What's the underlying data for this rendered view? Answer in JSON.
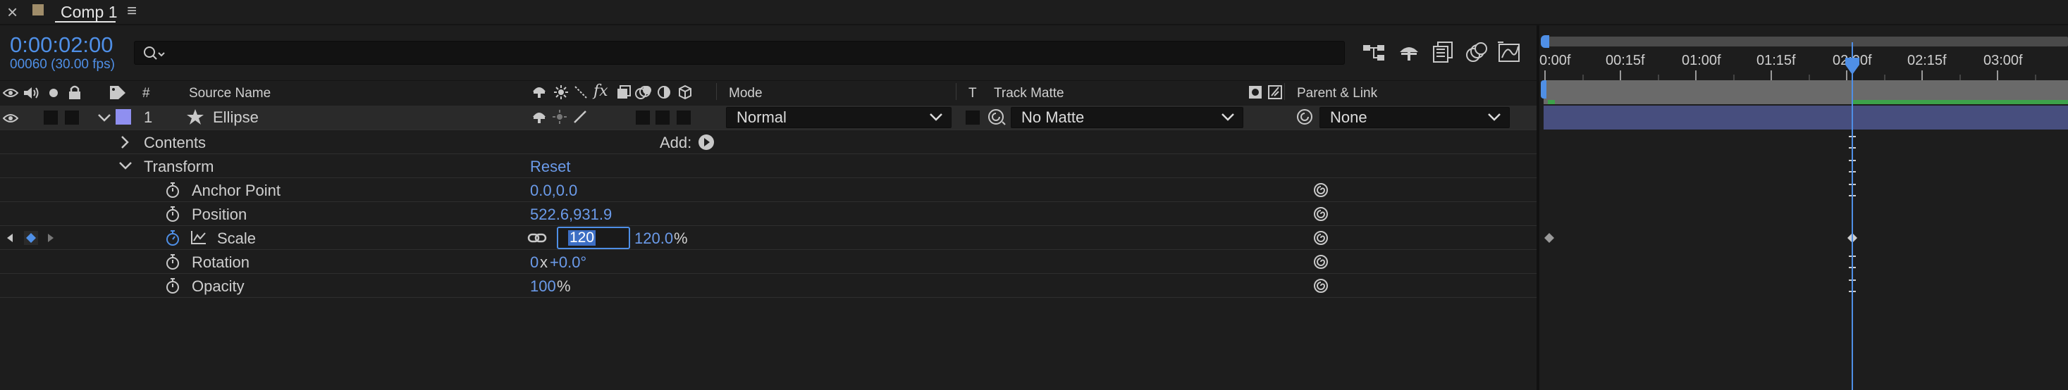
{
  "tab": {
    "title": "Comp 1",
    "close_glyph": "×",
    "menu_glyph": "≡",
    "swatch_color": "#a08d6a"
  },
  "header": {
    "timecode": "0:00:02:00",
    "frame_info": "00060 (30.00 fps)",
    "search_placeholder": ""
  },
  "columns": {
    "index": "#",
    "source_name": "Source Name",
    "fx": "fx",
    "mode": "Mode",
    "t": "T",
    "track_matte": "Track Matte",
    "parent_link": "Parent & Link"
  },
  "layer": {
    "index": "1",
    "name": "Ellipse",
    "label_color": "#8f8ff0",
    "mode": "Normal",
    "track_matte": "No Matte",
    "parent": "None"
  },
  "contents": {
    "label": "Contents",
    "add_label": "Add:"
  },
  "transform": {
    "label": "Transform",
    "reset_label": "Reset"
  },
  "properties": {
    "anchor_point": {
      "label": "Anchor Point",
      "value": "0.0,0.0"
    },
    "position": {
      "label": "Position",
      "value": "522.6,931.9"
    },
    "scale": {
      "label": "Scale",
      "edit_value": "120",
      "value": "120.0",
      "unit": "%"
    },
    "rotation": {
      "label": "Rotation",
      "revs": "0",
      "x": "x",
      "degrees": "+0.0°"
    },
    "opacity": {
      "label": "Opacity",
      "value": "100",
      "unit": "%"
    }
  },
  "ruler": {
    "ticks": [
      "0:00f",
      "00:15f",
      "01:00f",
      "01:15f",
      "02:00f",
      "02:15f",
      "03:00f"
    ],
    "current_time": "02:00f"
  },
  "colors": {
    "accent": "#4f8fe6",
    "layer_bar": "#474e7e",
    "work_area": "#3da24a",
    "panel_bg": "#1d1d1d"
  }
}
